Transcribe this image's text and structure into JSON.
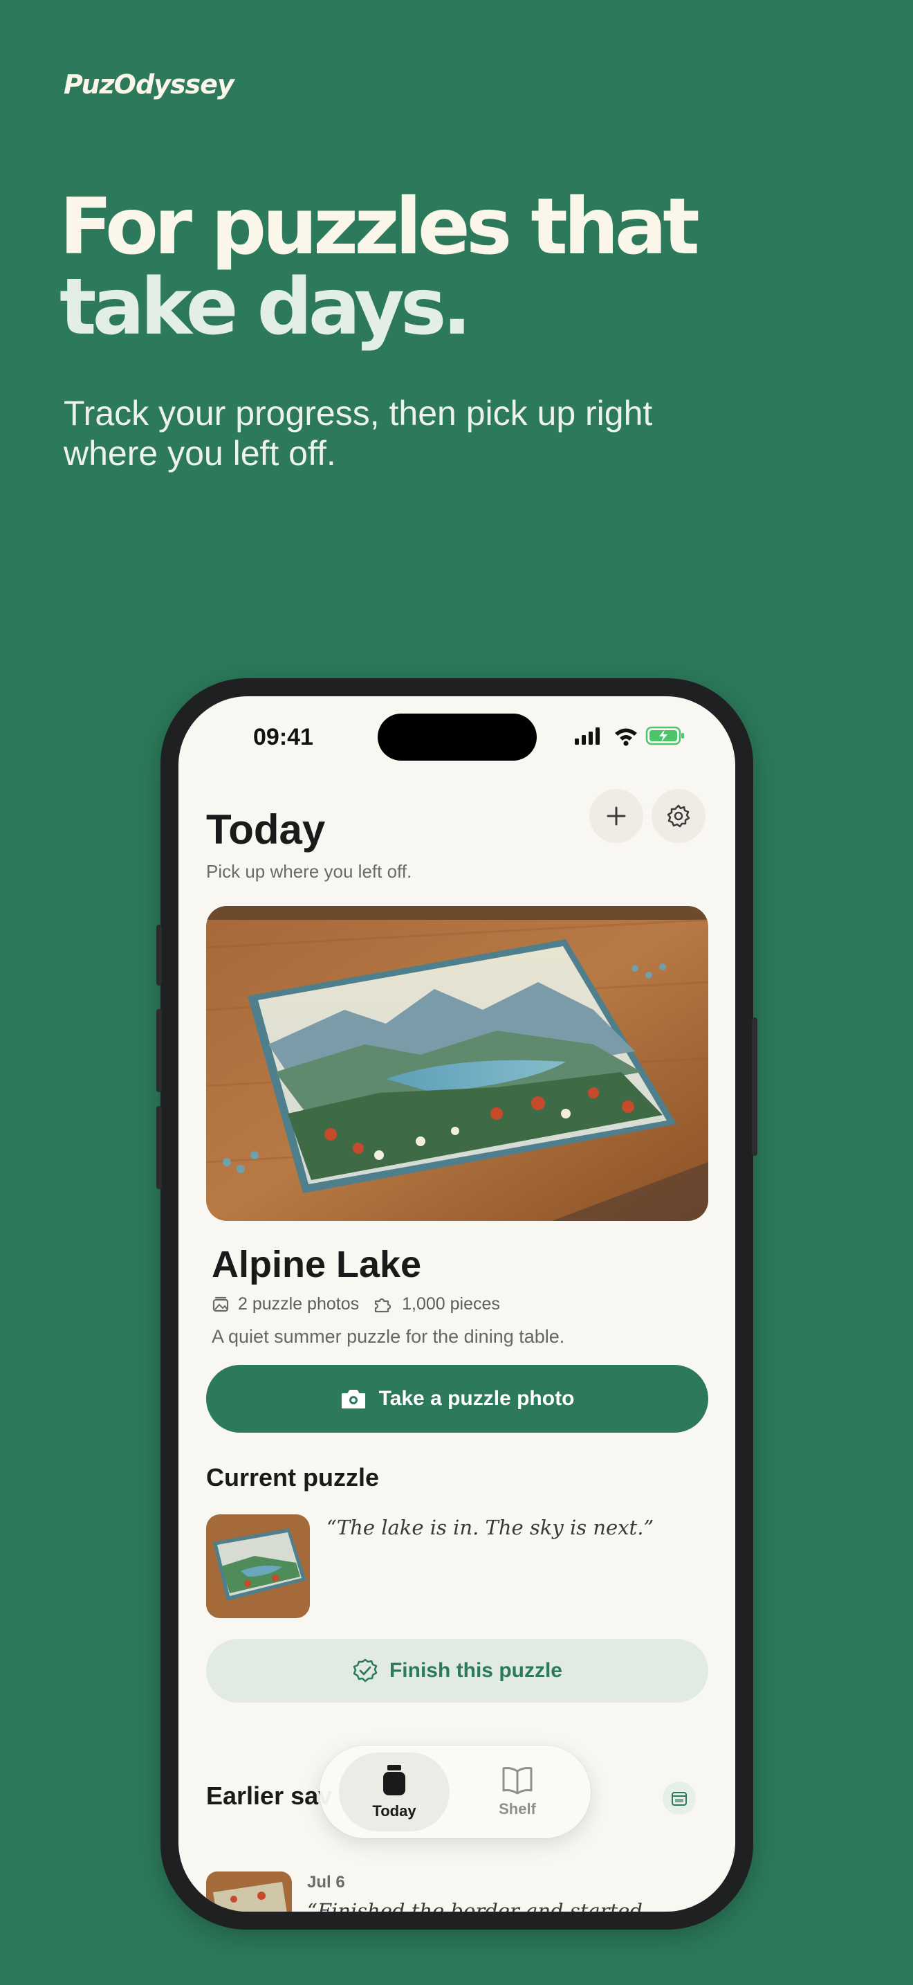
{
  "brand": {
    "logo": "PuzOdyssey"
  },
  "marketing": {
    "headline_line1": "For puzzles that",
    "headline_line2": "take days.",
    "subhead_line1": "Track your progress, then pick up right",
    "subhead_line2": "where you left off."
  },
  "status_bar": {
    "time": "09:41"
  },
  "header": {
    "title": "Today",
    "subtitle": "Pick up where you left off.",
    "add_icon": "plus-icon",
    "settings_icon": "gear-icon"
  },
  "puzzle": {
    "name": "Alpine Lake",
    "photos": "2 puzzle photos",
    "pieces": "1,000 pieces",
    "description": "A quiet summer puzzle for the dining table."
  },
  "actions": {
    "take_photo": "Take a puzzle photo",
    "finish": "Finish this puzzle"
  },
  "current": {
    "section_title": "Current puzzle",
    "quote": "“The lake is in. The sky is next.”"
  },
  "earlier": {
    "section_title": "Earlier sav",
    "items": [
      {
        "date": "Jul 6",
        "quote": "“Finished the border and started"
      }
    ]
  },
  "tabbar": {
    "tabs": [
      {
        "label": "Today",
        "icon": "jar-icon",
        "active": true
      },
      {
        "label": "Shelf",
        "icon": "book-icon",
        "active": false
      }
    ]
  },
  "colors": {
    "brand_green": "#2c7a5b",
    "cream": "#fbf6ea",
    "screen_bg": "#f9f7f2",
    "soft_green": "#e2ebe3"
  }
}
